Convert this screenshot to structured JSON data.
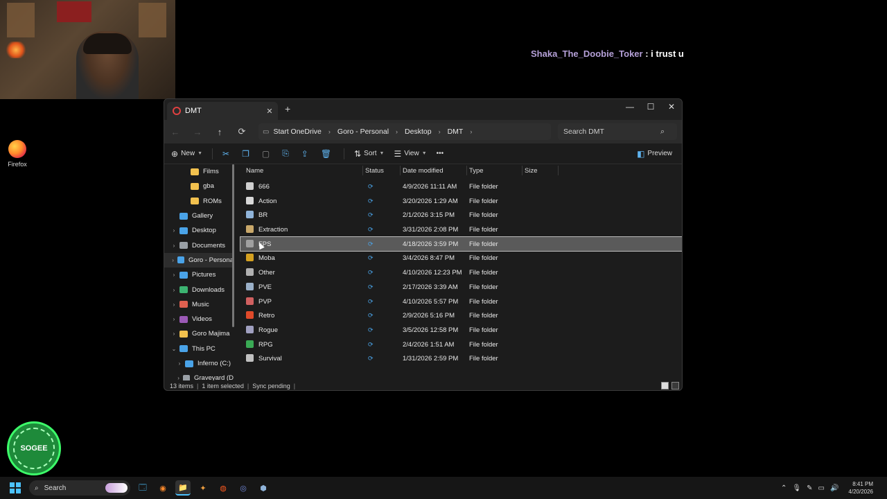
{
  "chat": {
    "username": "Shaka_The_Doobie_Toker",
    "separator": " : ",
    "message": "i trust u"
  },
  "desktop": {
    "firefox_label": "Firefox"
  },
  "logo": {
    "text": "SOGEE"
  },
  "window": {
    "tab_title": "DMT",
    "tab_close": "✕",
    "new_tab": "+",
    "minimize": "—",
    "maximize": "☐",
    "close": "✕"
  },
  "address": {
    "back": "←",
    "forward": "→",
    "up": "↑",
    "refresh": "⟳",
    "crumbs": [
      "Start OneDrive",
      "Goro - Personal",
      "Desktop",
      "DMT"
    ],
    "crumb_sep": "›",
    "search_placeholder": "Search DMT",
    "search_icon": "⌕"
  },
  "toolbar": {
    "new": "New",
    "sort": "Sort",
    "view": "View",
    "more": "•••",
    "preview": "Preview"
  },
  "nav": {
    "items": [
      {
        "label": "Films",
        "chev": "",
        "color": "#f2c14e"
      },
      {
        "label": "gba",
        "chev": "",
        "color": "#f2c14e"
      },
      {
        "label": "ROMs",
        "chev": "",
        "color": "#f2c14e"
      },
      {
        "label": "Gallery",
        "chev": "",
        "color": "#4aa3e8"
      },
      {
        "label": "Desktop",
        "chev": "›",
        "color": "#4aa3e8"
      },
      {
        "label": "Documents",
        "chev": "›",
        "color": "#9aa0a6"
      },
      {
        "label": "Goro - Persona",
        "chev": "›",
        "color": "#4aa3e8"
      },
      {
        "label": "Pictures",
        "chev": "›",
        "color": "#4aa3e8"
      },
      {
        "label": "Downloads",
        "chev": "›",
        "color": "#3cb371"
      },
      {
        "label": "Music",
        "chev": "›",
        "color": "#e06050"
      },
      {
        "label": "Videos",
        "chev": "›",
        "color": "#9b59b6"
      },
      {
        "label": "Goro Majima",
        "chev": "›",
        "color": "#f2c14e"
      },
      {
        "label": "This PC",
        "chev": "⌄",
        "color": "#4aa3e8"
      },
      {
        "label": "Inferno (C:)",
        "chev": "›",
        "color": "#4aa3e8"
      },
      {
        "label": "Graveyard (D",
        "chev": "›",
        "color": "#9aa0a6"
      }
    ]
  },
  "columns": {
    "name": "Name",
    "status": "Status",
    "date": "Date modified",
    "type": "Type",
    "size": "Size"
  },
  "files": [
    {
      "name": "666",
      "date": "4/9/2026 11:11 AM",
      "type": "File folder",
      "color": "#cfcfcf"
    },
    {
      "name": "Action",
      "date": "3/20/2026 1:29 AM",
      "type": "File folder",
      "color": "#d8d8d8"
    },
    {
      "name": "BR",
      "date": "2/1/2026 3:15 PM",
      "type": "File folder",
      "color": "#8fb3d9"
    },
    {
      "name": "Extraction",
      "date": "3/31/2026 2:08 PM",
      "type": "File folder",
      "color": "#c9a86a"
    },
    {
      "name": "FPS",
      "date": "4/18/2026 3:59 PM",
      "type": "File folder",
      "color": "#a0a0a0"
    },
    {
      "name": "Moba",
      "date": "3/4/2026 8:47 PM",
      "type": "File folder",
      "color": "#d4a020"
    },
    {
      "name": "Other",
      "date": "4/10/2026 12:23 PM",
      "type": "File folder",
      "color": "#b0b0b0"
    },
    {
      "name": "PVE",
      "date": "2/17/2026 3:39 AM",
      "type": "File folder",
      "color": "#9ab0c8"
    },
    {
      "name": "PVP",
      "date": "4/10/2026 5:57 PM",
      "type": "File folder",
      "color": "#d06060"
    },
    {
      "name": "Retro",
      "date": "2/9/2026 5:16 PM",
      "type": "File folder",
      "color": "#e04a2a"
    },
    {
      "name": "Rogue",
      "date": "3/5/2026 12:58 PM",
      "type": "File folder",
      "color": "#a0a0c0"
    },
    {
      "name": "RPG",
      "date": "2/4/2026 1:51 AM",
      "type": "File folder",
      "color": "#3aaa55"
    },
    {
      "name": "Survival",
      "date": "1/31/2026 2:59 PM",
      "type": "File folder",
      "color": "#c0c0c0"
    }
  ],
  "selected_index": 4,
  "status_icon": "⟳",
  "statusbar": {
    "count": "13 items",
    "selected": "1 item selected",
    "sync": "Sync pending",
    "sep": "|"
  },
  "taskbar": {
    "search": "Search",
    "time": "8:41 PM",
    "date": "4/20/2026",
    "apps": [
      "🗔",
      "◉",
      "📁",
      "✦",
      "◍",
      "◎",
      "⬢"
    ]
  }
}
